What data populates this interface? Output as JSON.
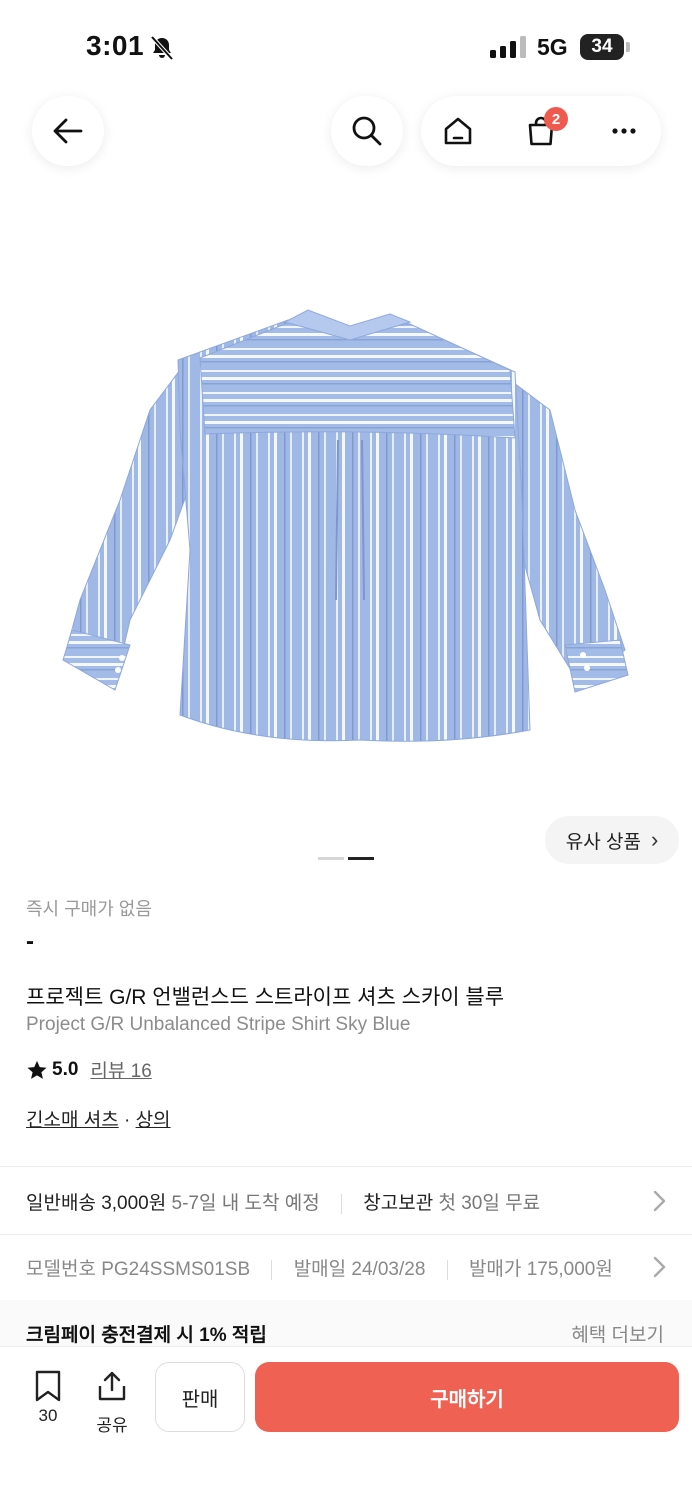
{
  "status": {
    "time": "3:01",
    "network": "5G",
    "battery": "34"
  },
  "nav": {
    "cart_count": "2"
  },
  "similar_label": "유사 상품",
  "similar_chevron": "›",
  "gallery": {
    "index": 2,
    "total": 2
  },
  "product": {
    "instant_label": "즉시 구매가 없음",
    "price": "-",
    "name_ko": "프로젝트 G/R 언밸런스드 스트라이프 셔츠 스카이 블루",
    "name_en": "Project G/R Unbalanced Stripe Shirt Sky Blue",
    "rating": "5.0",
    "review_label": "리뷰 16",
    "category_1": "긴소매 셔츠",
    "category_sep": " · ",
    "category_2": "상의"
  },
  "shipping": {
    "type": "일반배송",
    "fee": "3,000원",
    "eta": "5-7일 내 도착 예정",
    "storage": "창고보관",
    "storage_note": "첫 30일 무료"
  },
  "specs": {
    "model_label": "모델번호",
    "model_value": "PG24SSMS01SB",
    "release_label": "발매일",
    "release_value": "24/03/28",
    "retail_label": "발매가",
    "retail_value": "175,000원"
  },
  "benefit": {
    "title": "크림페이 충전결제 시 1% 적립",
    "more": "혜택 더보기"
  },
  "bottom": {
    "bookmark_count": "30",
    "share_label": "공유",
    "sell_label": "판매",
    "buy_label": "구매하기"
  },
  "colors": {
    "accent": "#ef6253",
    "badge": "#ef5a4f",
    "shirt": "#9db7e4"
  },
  "icons": [
    "back-arrow-icon",
    "search-icon",
    "home-icon",
    "shopping-bag-icon",
    "more-icon",
    "bookmark-icon",
    "share-icon",
    "star-icon",
    "bell-slash-icon"
  ]
}
